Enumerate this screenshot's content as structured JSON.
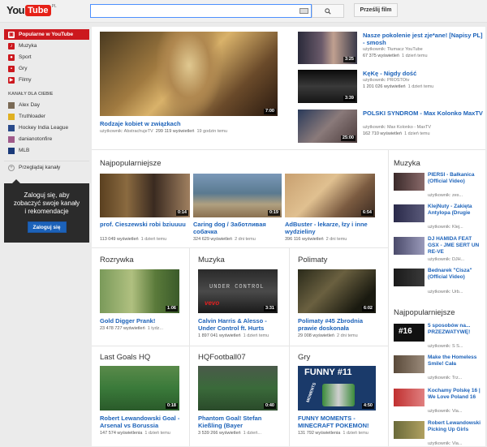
{
  "header": {
    "logo_you": "You",
    "logo_tube": "Tube",
    "logo_region": "PL",
    "search_value": "",
    "upload_label": "Prześlij film"
  },
  "sidebar": {
    "nav": [
      {
        "label": "Popularne w YouTube",
        "icon": "fire-icon"
      },
      {
        "label": "Muzyka",
        "icon": "music-icon"
      },
      {
        "label": "Sport",
        "icon": "sport-icon"
      },
      {
        "label": "Gry",
        "icon": "game-icon"
      },
      {
        "label": "Filmy",
        "icon": "film-icon"
      }
    ],
    "channels_header": "KANAŁY DLA CIEBIE",
    "channels": [
      {
        "label": "Alex Day",
        "color": "#7a6a55"
      },
      {
        "label": "Truthloader",
        "color": "#e0b020"
      },
      {
        "label": "Hockey India League",
        "color": "#2a4a8a"
      },
      {
        "label": "danianotonfire",
        "color": "#a05a8a"
      },
      {
        "label": "MLB",
        "color": "#1a3a7a"
      }
    ],
    "browse_label": "Przeglądaj kanały",
    "login_text": "Zaloguj się, aby zobaczyć swoje kanały i rekomendacje",
    "login_button": "Zaloguj się"
  },
  "featured": {
    "title": "Rodzaje kobiet w związkach",
    "user": "użytkownik: AbstrachujeTV",
    "views": "299 119 wyświetleń",
    "age": "19 godzin temu",
    "duration": "7:00"
  },
  "side_videos": [
    {
      "title": "Nasze pokolenie jest zje*ane! [Napisy PL] - smosh",
      "user": "użytkownik: Tłumacz YouTube",
      "views": "67 375 wyświetleń",
      "age": "1 dzień temu",
      "duration": "3:25"
    },
    {
      "title": "KęKę - Nigdy dość",
      "user": "użytkownik: PROSTOtv",
      "views": "1 201 026 wyświetleń",
      "age": "1 dzień temu",
      "duration": "3:39"
    },
    {
      "title": "POLSKI SYNDROM - Max Kolonko MaxTV",
      "user": "użytkownik: Max Kolonko - MaxTV",
      "views": "162 710 wyświetleń",
      "age": "1 dzień temu",
      "duration": "25:00"
    }
  ],
  "popular": {
    "header": "Najpopularniejsze",
    "videos": [
      {
        "title": "prof. Cieszewski robi bziuuuu",
        "views": "113 049 wyświetleń",
        "age": "1 dzień temu",
        "duration": "0:14"
      },
      {
        "title": "Caring dog / Заботливая собачка",
        "views": "324 629 wyświetleń",
        "age": "2 dni temu",
        "duration": "0:19"
      },
      {
        "title": "AdBuster - lekarze, łzy i inne wydzieliny",
        "views": "396 116 wyświetleń",
        "age": "2 dni temu",
        "duration": "6:54"
      }
    ]
  },
  "categories_row1": [
    {
      "header": "Rozrywka",
      "title": "Gold Digger Prank!",
      "views": "23 478 727 wyświetleń",
      "age": "1 tydz...",
      "duration": "1:06"
    },
    {
      "header": "Muzyka",
      "title": "Calvin Harris & Alesso - Under Control ft. Hurts",
      "views": "1 897 041 wyświetleń",
      "age": "1 dzień temu",
      "duration": "3:31"
    },
    {
      "header": "Polimaty",
      "title": "Polimaty #45 Zbrodnia prawie doskonała",
      "views": "29 008 wyświetleń",
      "age": "2 dni temu",
      "duration": "6:02"
    }
  ],
  "categories_row2": [
    {
      "header": "Last Goals HQ",
      "title": "Robert Lewandowski Goal - Arsenal vs Borussia",
      "views": "147 574 wyświetlenia",
      "age": "1 dzień temu",
      "duration": "0:18"
    },
    {
      "header": "HQFootball07",
      "title": "Phantom Goal! Stefan Kießling (Bayer",
      "views": "3 539 266 wyświetleń",
      "age": "1 dzień...",
      "duration": "0:40"
    },
    {
      "header": "Gry",
      "title": "FUNNY MOMENTS - MINECRAFT POKEMON!",
      "views": "131 792 wyświetlenia",
      "age": "1 dzień temu",
      "duration": "4:50"
    }
  ],
  "gry_thumb_text": "FUNNY #11",
  "gry_thumb_subtext": "MOMENTS",
  "muzyka_thumb_text": "UNDER CONTROL",
  "muzyka_thumb_logo": "vevo",
  "right_music": {
    "header": "Muzyka",
    "items": [
      {
        "title": "PIERSI - Bałkanica (Official Video)",
        "user": "użytkownik: zes..."
      },
      {
        "title": "KlejNuty - Zakięta Antylopa (Drugie",
        "user": "użytkownik: Klej..."
      },
      {
        "title": "DJ HAMIDA FEAT GSX - JME SERT UN RE-VE",
        "user": "użytkownik: DJH..."
      },
      {
        "title": "Bednarek \"Cisza\" (Official Video)",
        "user": "użytkownik: Urb..."
      }
    ]
  },
  "right_popular": {
    "header": "Najpopularniejsze",
    "items": [
      {
        "title": "5 sposobów na... PRZEZWATYWĘ!",
        "user": "użytkownik: S S..."
      },
      {
        "title": "Make the Homeless Smile! Cała",
        "user": "użytkownik: Trz..."
      },
      {
        "title": "Kochamy Polskę 16 | We Love Poland 16",
        "user": "użytkownik: Via..."
      },
      {
        "title": "Robert Lewandowski Picking Up Girls",
        "user": "użytkownik: Via..."
      }
    ]
  },
  "right_thumb_labels": {
    "p1": "#16"
  }
}
